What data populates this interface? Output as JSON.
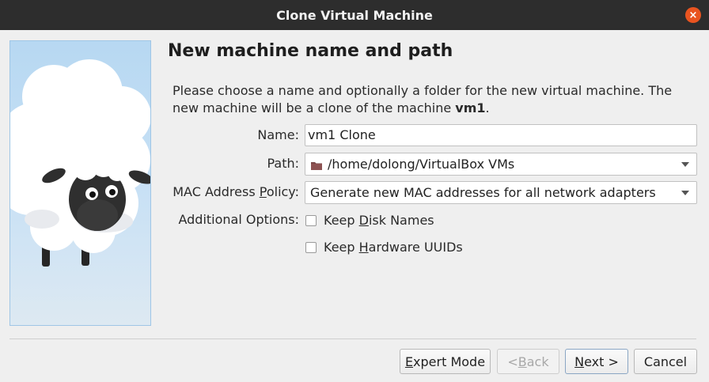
{
  "window": {
    "title": "Clone Virtual Machine",
    "close_icon": "×"
  },
  "page": {
    "title": "New machine name and path",
    "description_text": "Please choose a name and optionally a folder for the new virtual machine. The new machine will be a clone of the machine ",
    "source_machine": "vm1",
    "description_end": "."
  },
  "form": {
    "name_label": "Name:",
    "name_value": "vm1 Clone",
    "path_label": "Path:",
    "path_value": "/home/dolong/VirtualBox VMs",
    "mac_label_pre": "MAC Address ",
    "mac_label_accel": "P",
    "mac_label_post": "olicy:",
    "mac_value": "Generate new MAC addresses for all network adapters",
    "additional_label": "Additional Options:",
    "keep_disk_pre": "Keep ",
    "keep_disk_accel": "D",
    "keep_disk_post": "isk Names",
    "keep_disk_checked": false,
    "keep_hw_pre": "Keep ",
    "keep_hw_accel": "H",
    "keep_hw_post": "ardware UUIDs",
    "keep_hw_checked": false
  },
  "buttons": {
    "expert_accel": "E",
    "expert_rest": "xpert Mode",
    "back_lt": "< ",
    "back_accel": "B",
    "back_rest": "ack",
    "next_accel": "N",
    "next_rest": "ext >",
    "cancel": "Cancel"
  },
  "icons": {
    "folder": "folder-icon",
    "combo_arrow": "chevron-down-icon",
    "close": "close-icon"
  },
  "colors": {
    "titlebar": "#2d2d2d",
    "close_button": "#e95420",
    "dialog_bg": "#efefef"
  }
}
